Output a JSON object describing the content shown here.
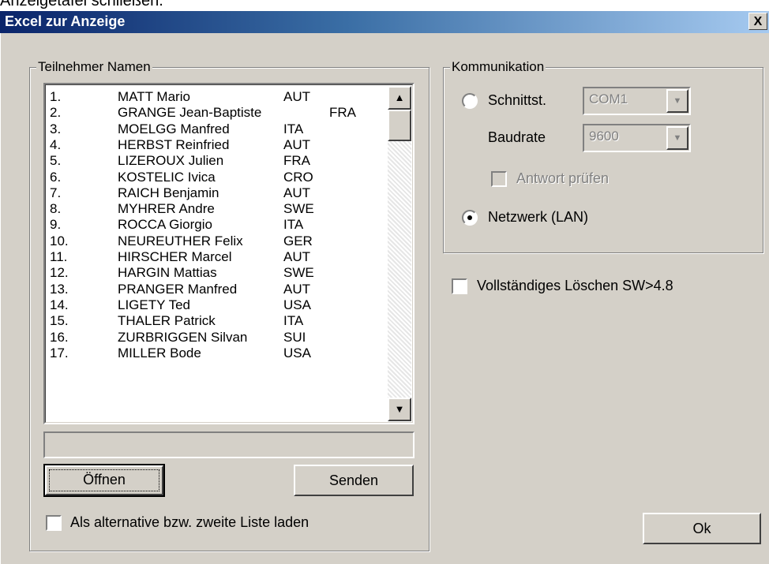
{
  "top_strip_text": "Anzeigetafel schließen.",
  "window": {
    "title": "Excel zur Anzeige",
    "close_label": "X"
  },
  "participants_group": {
    "legend": "Teilnehmer Namen",
    "rows": [
      {
        "num": "1.",
        "name": "MATT Mario",
        "nation": "AUT"
      },
      {
        "num": "2.",
        "name": "GRANGE Jean-Baptiste",
        "nation": "FRA"
      },
      {
        "num": "3.",
        "name": "MOELGG Manfred",
        "nation": "ITA"
      },
      {
        "num": "4.",
        "name": "HERBST Reinfried",
        "nation": "AUT"
      },
      {
        "num": "5.",
        "name": "LIZEROUX Julien",
        "nation": "FRA"
      },
      {
        "num": "6.",
        "name": "KOSTELIC Ivica",
        "nation": "CRO"
      },
      {
        "num": "7.",
        "name": "RAICH Benjamin",
        "nation": "AUT"
      },
      {
        "num": "8.",
        "name": "MYHRER Andre",
        "nation": "SWE"
      },
      {
        "num": "9.",
        "name": "ROCCA Giorgio",
        "nation": "ITA"
      },
      {
        "num": "10.",
        "name": "NEUREUTHER Felix",
        "nation": "GER"
      },
      {
        "num": "11.",
        "name": "HIRSCHER Marcel",
        "nation": "AUT"
      },
      {
        "num": "12.",
        "name": "HARGIN Mattias",
        "nation": "SWE"
      },
      {
        "num": "13.",
        "name": "PRANGER Manfred",
        "nation": "AUT"
      },
      {
        "num": "14.",
        "name": "LIGETY Ted",
        "nation": "USA"
      },
      {
        "num": "15.",
        "name": "THALER Patrick",
        "nation": "ITA"
      },
      {
        "num": "16.",
        "name": "ZURBRIGGEN Silvan",
        "nation": "SUI"
      },
      {
        "num": "17.",
        "name": "MILLER Bode",
        "nation": "USA"
      }
    ],
    "status_text": "",
    "open_button": "Öffnen",
    "send_button": "Senden",
    "alt_list_label": "Als alternative bzw. zweite Liste laden"
  },
  "communication_group": {
    "legend": "Kommunikation",
    "serial_label": "Schnittst.",
    "com_value": "COM1",
    "baud_label": "Baudrate",
    "baud_value": "9600",
    "check_response_label": "Antwort prüfen",
    "network_label": "Netzwerk (LAN)"
  },
  "full_delete_label": "Vollständiges Löschen SW>4.8",
  "ok_button": "Ok"
}
